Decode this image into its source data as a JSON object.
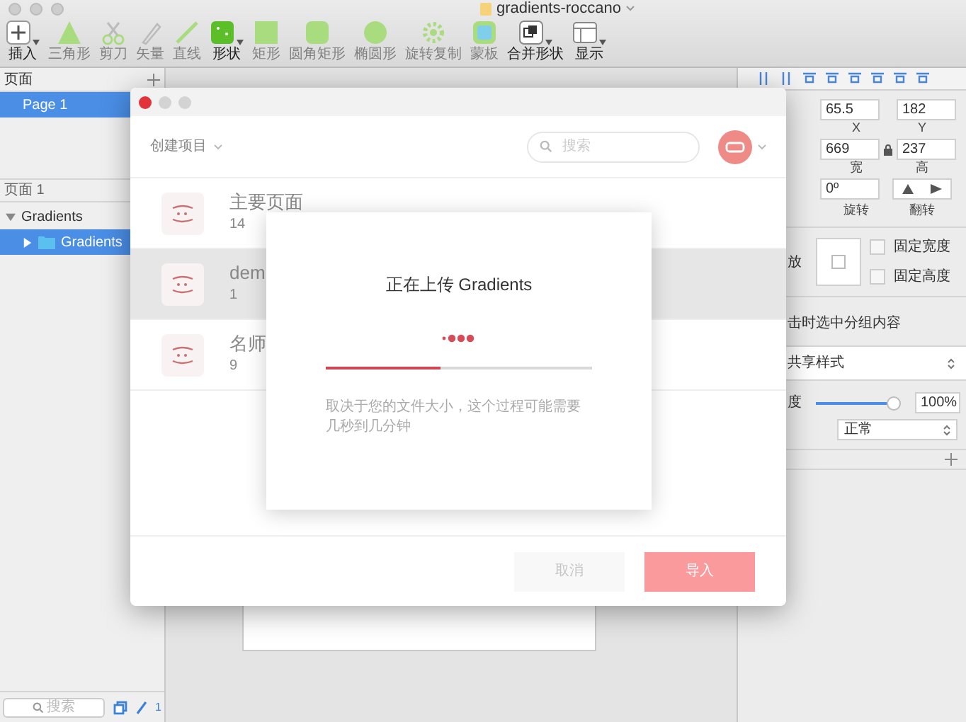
{
  "window": {
    "title": "gradients-roccano"
  },
  "toolbar": [
    {
      "kind": "plus",
      "label": "插入",
      "disabled": false
    },
    {
      "kind": "triangle",
      "label": "三角形",
      "disabled": true
    },
    {
      "kind": "scissors",
      "label": "剪刀",
      "disabled": true
    },
    {
      "kind": "pen",
      "label": "矢量",
      "disabled": true
    },
    {
      "kind": "line",
      "label": "直线",
      "disabled": true
    },
    {
      "kind": "shape",
      "label": "形状",
      "disabled": false
    },
    {
      "kind": "rect",
      "label": "矩形",
      "disabled": true
    },
    {
      "kind": "rounded",
      "label": "圆角矩形",
      "disabled": true
    },
    {
      "kind": "oval",
      "label": "椭圆形",
      "disabled": true
    },
    {
      "kind": "gear",
      "label": "旋转复制",
      "disabled": true
    },
    {
      "kind": "mask",
      "label": "蒙板",
      "disabled": true
    },
    {
      "kind": "combine",
      "label": "合并形状",
      "disabled": false
    },
    {
      "kind": "view",
      "label": "显示",
      "disabled": false
    }
  ],
  "sidebar": {
    "pages_title": "页面",
    "pages": [
      {
        "label": "Page 1",
        "selected": true
      }
    ],
    "layers_title": "页面 1",
    "layers": [
      {
        "label": "Gradients",
        "selected": false,
        "expanded": true,
        "children": [
          {
            "label": "Gradients",
            "selected": true,
            "expanded": false
          }
        ]
      }
    ],
    "search": {
      "placeholder": "搜索"
    },
    "count": "1"
  },
  "inspector": {
    "x": {
      "value": "65.5",
      "label": "X"
    },
    "y": {
      "value": "182",
      "label": "Y"
    },
    "width": {
      "value": "669",
      "label": "宽"
    },
    "height": {
      "value": "237",
      "label": "高"
    },
    "rotation": {
      "value": "0º",
      "label": "旋转"
    },
    "flip_label": "翻转",
    "resizing_label": "放",
    "fix_width": "固定宽度",
    "fix_height": "固定高度",
    "click_through": "击时选中分组内容",
    "shared_style": "共享样式",
    "opacity": {
      "label": "度",
      "level": 1,
      "reading": "100%"
    },
    "blend": "正常"
  },
  "dialog": {
    "create_label": "创建项目",
    "search": {
      "placeholder": "搜索"
    },
    "projects": [
      {
        "name": "主要页面",
        "meta": "14",
        "selected": false
      },
      {
        "name": "dem",
        "meta": "1",
        "selected": true
      },
      {
        "name": "名师",
        "meta": "9",
        "selected": false
      }
    ],
    "buttons": [
      {
        "label": "取消",
        "kind": "secondary"
      },
      {
        "label": "导入",
        "kind": "primary"
      }
    ]
  },
  "upload": {
    "title": "正在上传 Gradients",
    "level": 0.43,
    "note": "取决于您的文件大小，这个过程可能需要几秒到几分钟"
  }
}
